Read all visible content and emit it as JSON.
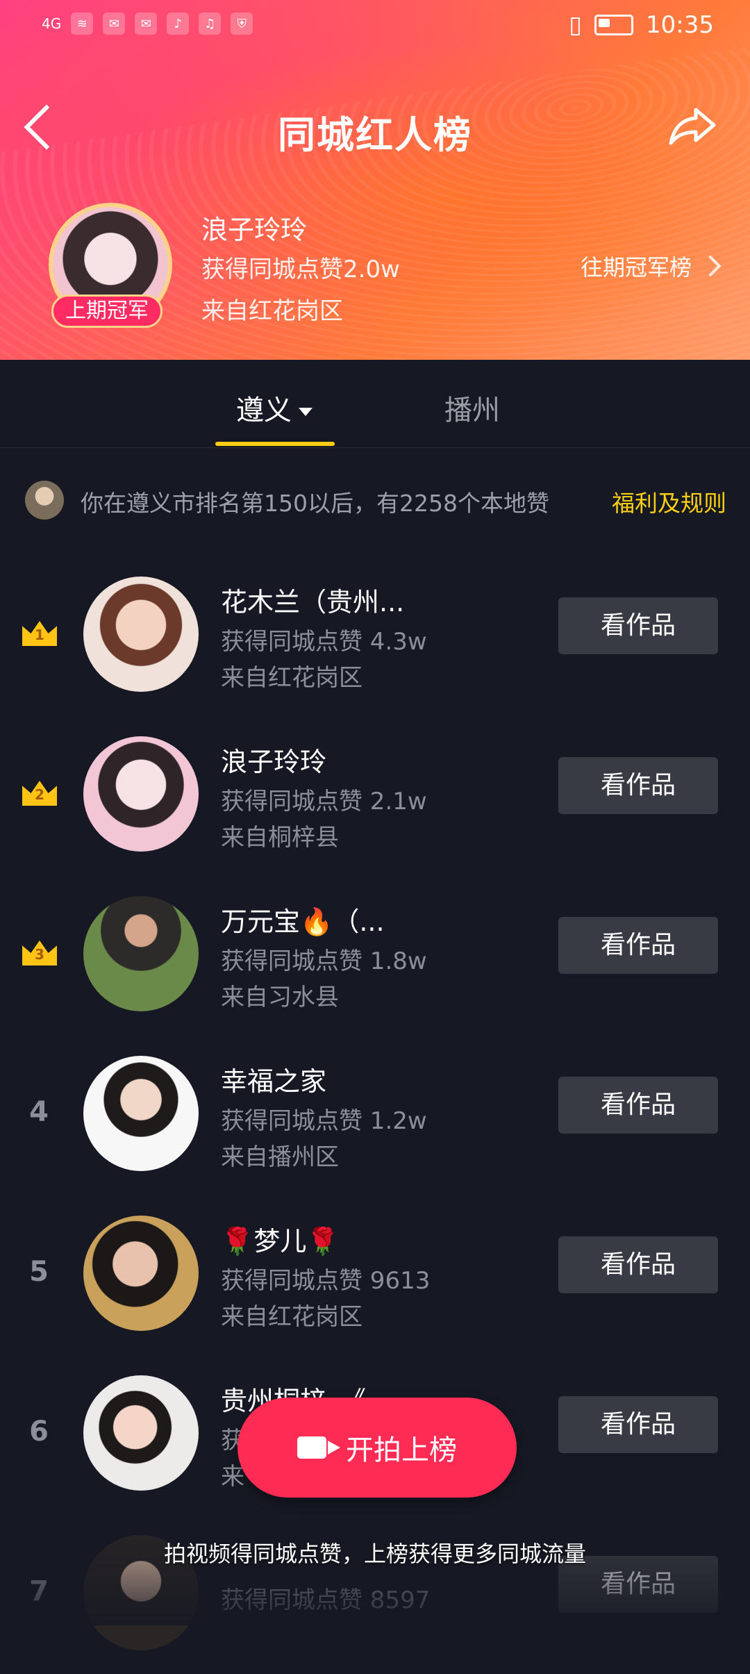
{
  "status_bar": {
    "network": "4G",
    "time": "10:35"
  },
  "header": {
    "title": "同城红人榜",
    "champion": {
      "name": "浪子玲玲",
      "likes": "获得同城点赞2.0w",
      "from": "来自红花岗区",
      "badge": "上期冠军"
    },
    "past_champions_link": "往期冠军榜"
  },
  "tabs": [
    {
      "label": "遵义",
      "active": true
    },
    {
      "label": "播州",
      "active": false
    }
  ],
  "rank_notice": {
    "text": "你在遵义市排名第150以后，有2258个本地赞",
    "rules_link": "福利及规则"
  },
  "list": [
    {
      "rank": "1",
      "name": "花木兰（贵州...",
      "likes": "获得同城点赞 4.3w",
      "from": "来自红花岗区",
      "button": "看作品"
    },
    {
      "rank": "2",
      "name": "浪子玲玲",
      "likes": "获得同城点赞 2.1w",
      "from": "来自桐梓县",
      "button": "看作品"
    },
    {
      "rank": "3",
      "name": "万元宝🔥（...",
      "likes": "获得同城点赞 1.8w",
      "from": "来自习水县",
      "button": "看作品"
    },
    {
      "rank": "4",
      "name": "幸福之家",
      "likes": "获得同城点赞 1.2w",
      "from": "来自播州区",
      "button": "看作品"
    },
    {
      "rank": "5",
      "name": "🌹梦儿🌹",
      "likes": "获得同城点赞 9613",
      "from": "来自红花岗区",
      "button": "看作品"
    },
    {
      "rank": "6",
      "name": "贵州桐梓。《",
      "likes": "获",
      "from": "来",
      "button": "看作品"
    },
    {
      "rank": "7",
      "name": "",
      "likes": "获得同城点赞 8597",
      "from": "",
      "button": "看作品"
    }
  ],
  "cta": {
    "label": "开拍上榜",
    "tip": "拍视频得同城点赞，上榜获得更多同城流量"
  },
  "colors": {
    "accent": "#fe2c55",
    "tab_underline": "#face15",
    "background": "#161823",
    "button": "#393b44"
  }
}
